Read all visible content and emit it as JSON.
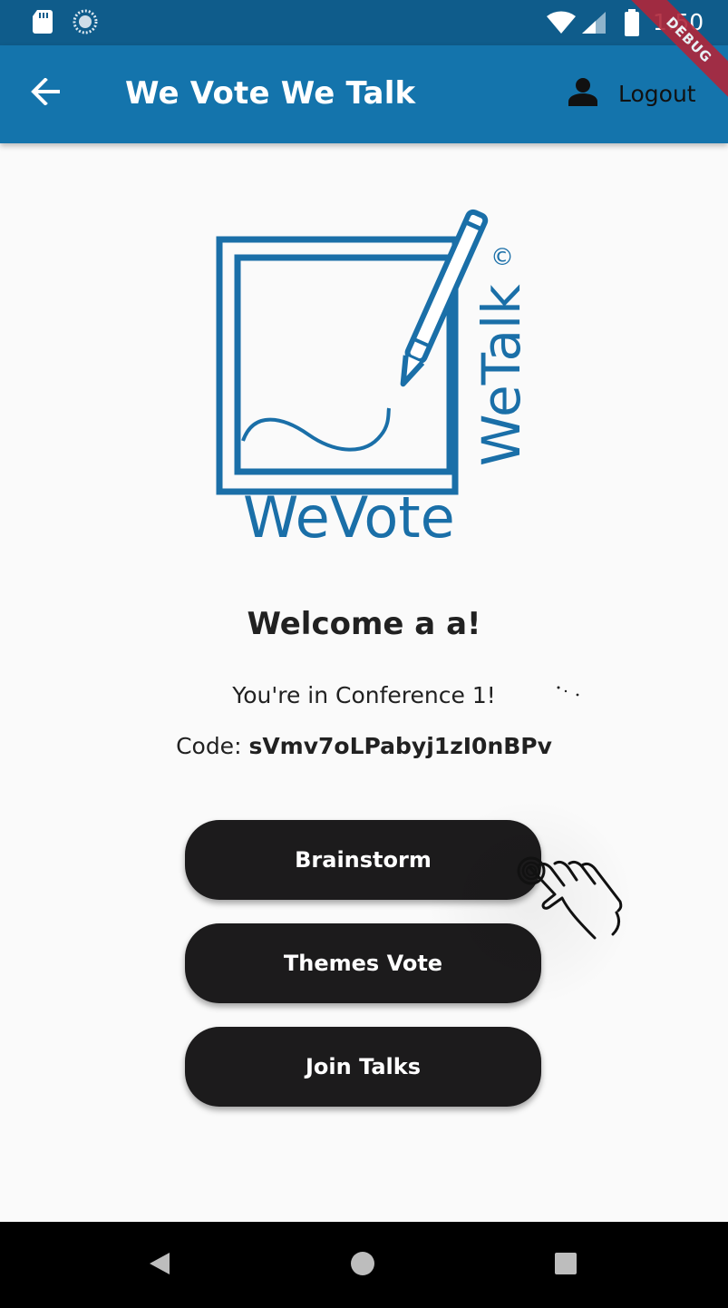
{
  "status_bar": {
    "time": "1:50",
    "icons": [
      "sd-card-icon",
      "sync-icon",
      "wifi-icon",
      "cellular-signal-icon",
      "battery-icon"
    ]
  },
  "app_bar": {
    "title": "We Vote We Talk",
    "back_icon": "arrow-back-icon",
    "logout_label": "Logout",
    "logout_icon": "person-icon"
  },
  "debug_banner": {
    "label": "DEBUG"
  },
  "logo": {
    "text_bottom": "WeVote",
    "text_side": "WeTalk",
    "copyright": "©",
    "color": "#1a6fa8"
  },
  "main": {
    "welcome": "Welcome a a!",
    "conference": "You're in Conference 1!",
    "code_label": "Code: ",
    "code_value": "sVmv7oLPabyj1zI0nBPv"
  },
  "buttons": {
    "brainstorm": "Brainstorm",
    "themes_vote": "Themes Vote",
    "join_talks": "Join Talks"
  },
  "nav_bar": {
    "icons": [
      "nav-back-icon",
      "nav-home-icon",
      "nav-recents-icon"
    ]
  },
  "colors": {
    "status_bar": "#0f5c8b",
    "app_bar": "#1474ac",
    "button_bg": "#1c1b1c",
    "background": "#fafafa"
  }
}
